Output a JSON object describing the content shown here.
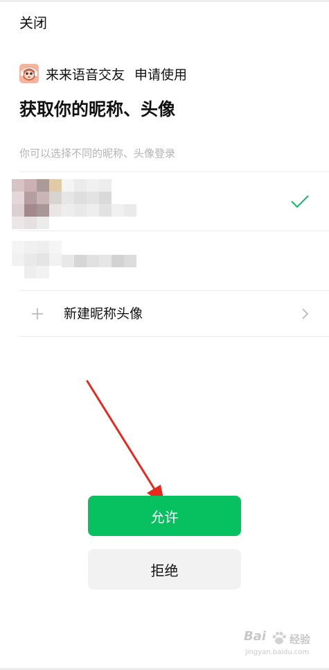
{
  "header": {
    "close_label": "关闭"
  },
  "app": {
    "name": "来来语音交友",
    "request_text": "申请使用",
    "icon": "monkey-avatar-icon"
  },
  "page": {
    "title": "获取你的昵称、头像",
    "subtitle": "你可以选择不同的昵称、头像登录"
  },
  "accounts": [
    {
      "selected": true,
      "avatar": "blurred-avatar",
      "nickname": "blurred-nickname"
    },
    {
      "selected": false,
      "avatar": "blurred-avatar",
      "nickname": "blurred-nickname"
    }
  ],
  "new_profile": {
    "label": "新建昵称头像",
    "icon": "plus-icon",
    "chevron": "chevron-right-icon"
  },
  "buttons": {
    "allow_label": "允许",
    "reject_label": "拒绝"
  },
  "colors": {
    "primary_green": "#07c160",
    "check_green": "#07c160",
    "reject_bg": "#f2f2f2",
    "subtitle_gray": "#b3b3b3",
    "arrow_red": "#e8271d"
  },
  "watermark": {
    "brand": "Bai",
    "product": "经验",
    "url": "jingyan.baidu.com"
  }
}
